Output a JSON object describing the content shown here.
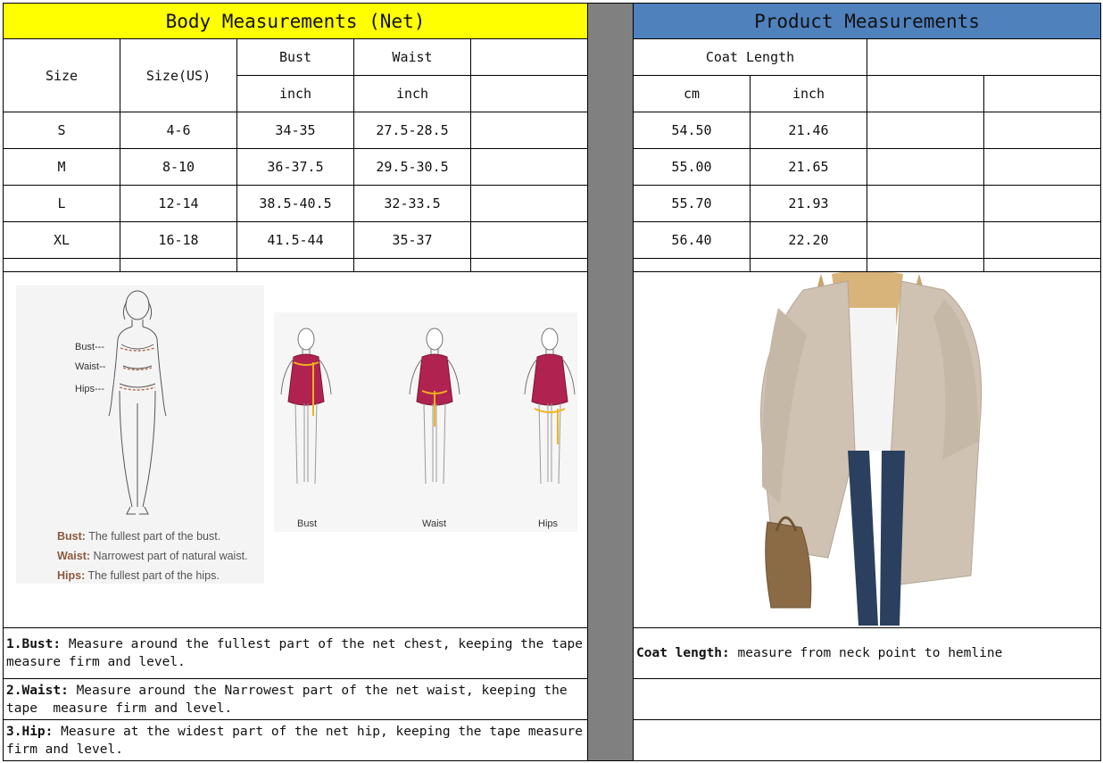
{
  "body_table": {
    "title": "Body Measurements (Net)",
    "col_size": "Size",
    "col_size_us": "Size(US)",
    "col_bust": "Bust",
    "col_waist": "Waist",
    "unit_bust": "inch",
    "unit_waist": "inch",
    "rows": [
      {
        "size": "S",
        "size_us": "4-6",
        "bust": "34-35",
        "waist": "27.5-28.5"
      },
      {
        "size": "M",
        "size_us": "8-10",
        "bust": "36-37.5",
        "waist": "29.5-30.5"
      },
      {
        "size": "L",
        "size_us": "12-14",
        "bust": "38.5-40.5",
        "waist": "32-33.5"
      },
      {
        "size": "XL",
        "size_us": "16-18",
        "bust": "41.5-44",
        "waist": "35-37"
      }
    ]
  },
  "product_table": {
    "title": "Product Measurements",
    "col_coat_length": "Coat Length",
    "unit_cm": "cm",
    "unit_inch": "inch",
    "rows": [
      {
        "cm": "54.50",
        "inch": "21.46"
      },
      {
        "cm": "55.00",
        "inch": "21.65"
      },
      {
        "cm": "55.70",
        "inch": "21.93"
      },
      {
        "cm": "56.40",
        "inch": "22.20"
      }
    ]
  },
  "body_diagram": {
    "label_bust": "Bust---",
    "label_waist": "Waist--",
    "label_hips": "Hips---",
    "legend": [
      {
        "term": "Bust:",
        "desc": "The fullest part of the bust."
      },
      {
        "term": "Waist:",
        "desc": "Narrowest part of natural waist."
      },
      {
        "term": "Hips:",
        "desc": "The fullest part of the hips."
      }
    ]
  },
  "dress_diagram": {
    "labels": [
      "Bust",
      "Waist",
      "Hips"
    ],
    "dress_color": "#b0224f",
    "tape_color": "#f2b21c"
  },
  "colors": {
    "header_yellow": "#ffff00",
    "header_blue": "#4f81bd",
    "divider_gray": "#808080",
    "coat_beige": "#cfc2b2"
  },
  "notes": {
    "bust_term": "1.Bust:",
    "bust_text": " Measure around the fullest part of the net chest, keeping the tape  measure firm and level.",
    "waist_term": "2.Waist:",
    "waist_text": " Measure around the Narrowest part of the net waist, keeping the tape  measure firm and level.",
    "hip_term": "3.Hip:",
    "hip_text": " Measure at the widest part of the net hip, keeping the tape measure firm and level.",
    "coat_term": "Coat length:",
    "coat_text": " measure from neck point to hemline"
  }
}
